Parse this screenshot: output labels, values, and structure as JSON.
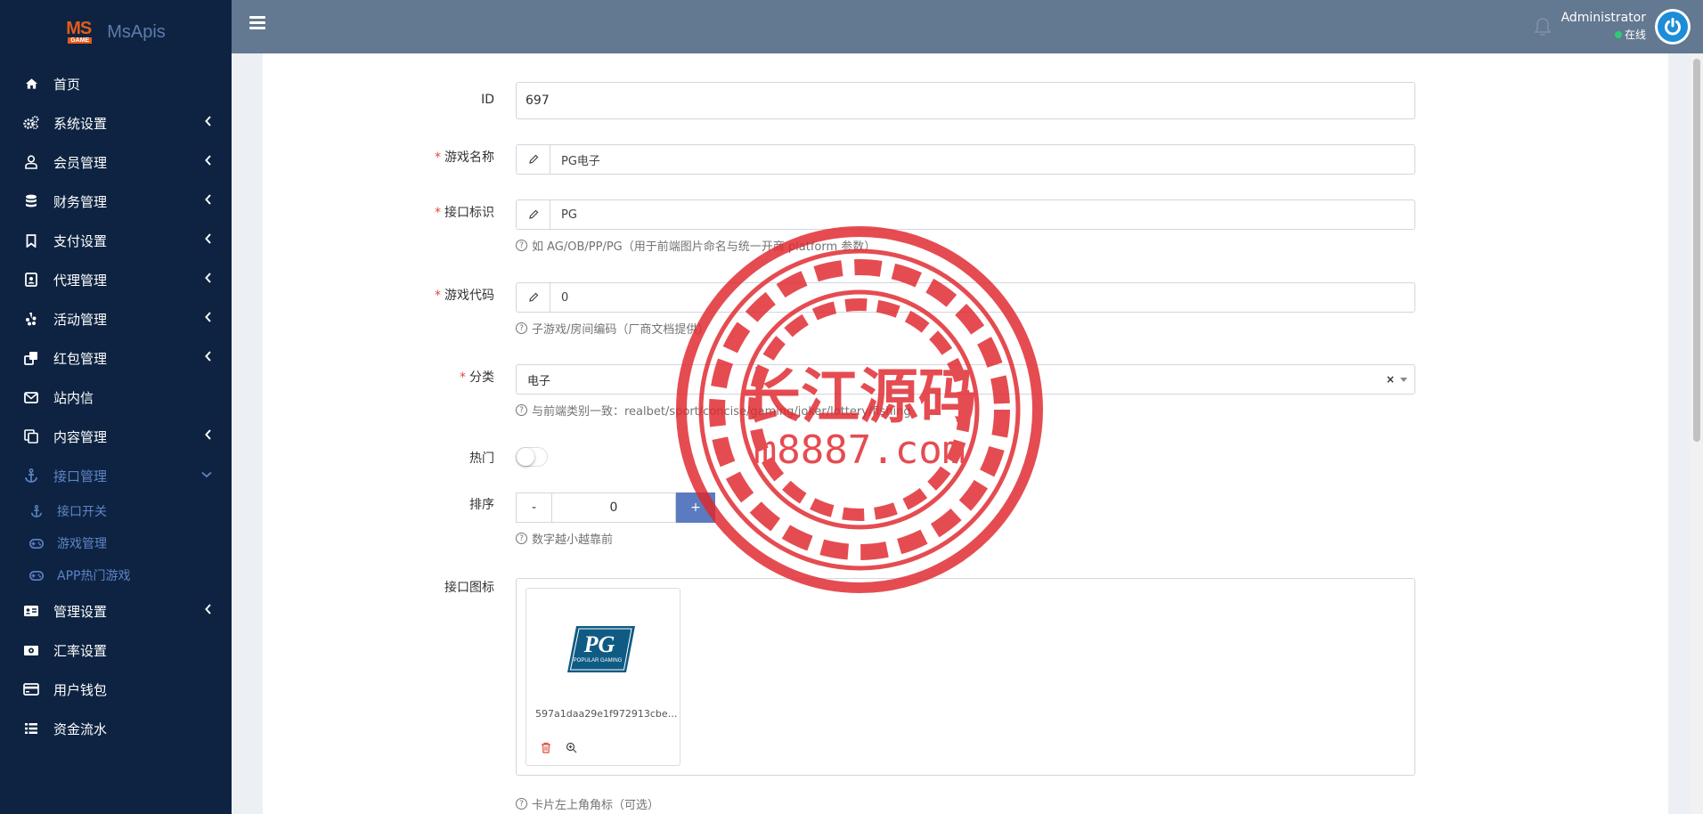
{
  "brand": {
    "logo_ms": "MS",
    "logo_game": "GAME",
    "name": "MsApis"
  },
  "sidebar": {
    "items": [
      {
        "label": "首页",
        "icon": "home-icon",
        "arrow": false
      },
      {
        "label": "系统设置",
        "icon": "cogs-icon",
        "arrow": true
      },
      {
        "label": "会员管理",
        "icon": "user-icon",
        "arrow": true
      },
      {
        "label": "财务管理",
        "icon": "database-icon",
        "arrow": true
      },
      {
        "label": "支付设置",
        "icon": "bookmark-icon",
        "arrow": true
      },
      {
        "label": "代理管理",
        "icon": "id-badge-icon",
        "arrow": true
      },
      {
        "label": "活动管理",
        "icon": "yelp-icon",
        "arrow": true
      },
      {
        "label": "红包管理",
        "icon": "clone-icon",
        "arrow": true
      },
      {
        "label": "站内信",
        "icon": "envelope-icon",
        "arrow": false
      },
      {
        "label": "内容管理",
        "icon": "copy-icon",
        "arrow": true
      },
      {
        "label": "接口管理",
        "icon": "anchor-icon",
        "arrow": true,
        "active": true
      },
      {
        "label": "管理设置",
        "icon": "id-card-icon",
        "arrow": true
      },
      {
        "label": "汇率设置",
        "icon": "money-icon",
        "arrow": false
      },
      {
        "label": "用户钱包",
        "icon": "credit-card-icon",
        "arrow": false
      },
      {
        "label": "资金流水",
        "icon": "list-icon",
        "arrow": false
      }
    ],
    "sub_items": [
      {
        "label": "接口开关",
        "icon": "anchor-icon"
      },
      {
        "label": "游戏管理",
        "icon": "gamepad-icon"
      },
      {
        "label": "APP热门游戏",
        "icon": "gamepad-icon"
      }
    ]
  },
  "header": {
    "user_name": "Administrator",
    "user_status": "在线"
  },
  "form": {
    "id": {
      "label": "ID",
      "value": "697"
    },
    "game_name": {
      "label": "游戏名称",
      "value": "PG电子"
    },
    "api_code": {
      "label": "接口标识",
      "value": "PG",
      "help": "如 AG/OB/PP/PG（用于前端图片命名与统一开商 platform 参数）"
    },
    "game_code": {
      "label": "游戏代码",
      "value": "0",
      "help": "子游戏/房间编码（厂商文档提供）"
    },
    "category": {
      "label": "分类",
      "value": "电子",
      "help": "与前端类别一致：realbet/sport/concise/gaming/joker/lottery/fishing"
    },
    "hot": {
      "label": "热门"
    },
    "sort": {
      "label": "排序",
      "minus": "-",
      "value": "0",
      "plus": "+",
      "help": "数字越小越靠前"
    },
    "icon": {
      "label": "接口图标",
      "filename": "597a1daa29e1f972913cbef...",
      "logo_text": "PG",
      "logo_sub": "POPULAR GAMING"
    },
    "corner": {
      "help": "卡片左上角角标（可选）"
    }
  },
  "watermark": {
    "title": "长江源码",
    "url": "m8887.com"
  },
  "colors": {
    "sidebar": "#0d2341",
    "header": "#637891",
    "accent": "#5b7bc0",
    "required": "#dd4b39",
    "watermark": "#e0262b"
  }
}
